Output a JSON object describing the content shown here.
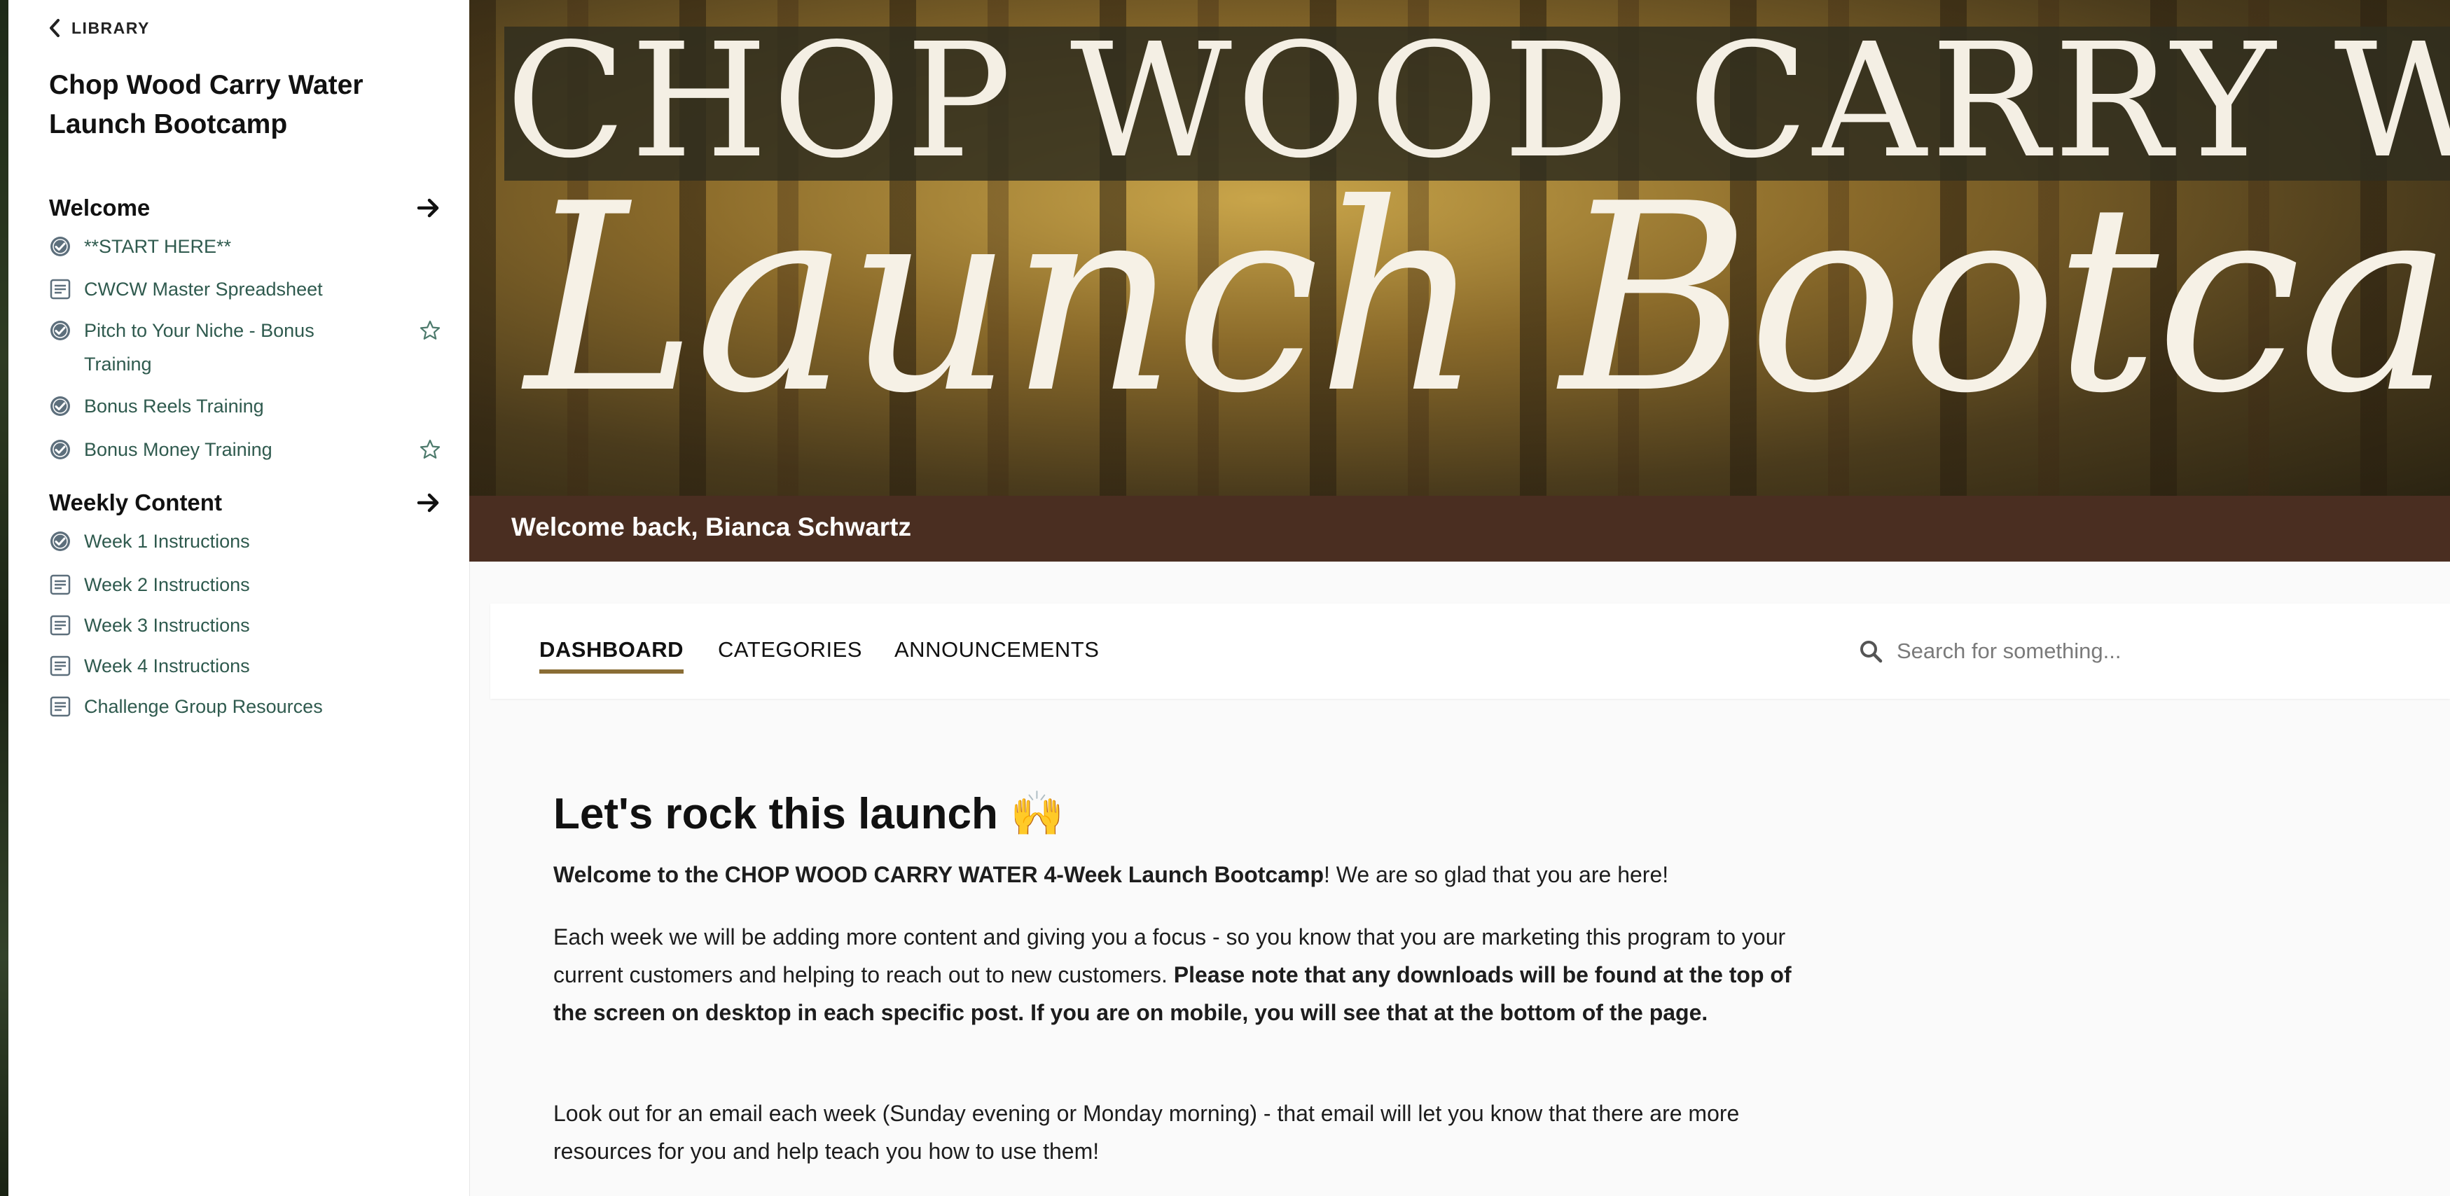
{
  "sidebar": {
    "back_label": "LIBRARY",
    "course_title": "Chop Wood Carry Water Launch Bootcamp",
    "sections": [
      {
        "title": "Welcome",
        "lessons": [
          {
            "label": "**START HERE**",
            "icon": "check-circle-icon",
            "starred": false
          },
          {
            "label": "CWCW Master Spreadsheet",
            "icon": "document-icon",
            "starred": false
          },
          {
            "label": "Pitch to Your Niche - Bonus Training",
            "icon": "check-circle-icon",
            "starred": true
          },
          {
            "label": "Bonus Reels Training",
            "icon": "check-circle-icon",
            "starred": false
          },
          {
            "label": "Bonus Money Training",
            "icon": "check-circle-icon",
            "starred": true
          }
        ]
      },
      {
        "title": "Weekly Content",
        "lessons": [
          {
            "label": "Week 1 Instructions",
            "icon": "check-circle-icon",
            "starred": false
          },
          {
            "label": "Week 2 Instructions",
            "icon": "document-icon",
            "starred": false
          },
          {
            "label": "Week 3 Instructions",
            "icon": "document-icon",
            "starred": false
          },
          {
            "label": "Week 4 Instructions",
            "icon": "document-icon",
            "starred": false
          },
          {
            "label": "Challenge Group Resources",
            "icon": "document-icon",
            "starred": false
          }
        ]
      }
    ]
  },
  "hero": {
    "line1": "CHOP WOOD CARRY WATER",
    "line2": "Launch Bootcamp"
  },
  "welcome_text": "Welcome back, Bianca Schwartz",
  "tabs": [
    {
      "label": "DASHBOARD",
      "active": true
    },
    {
      "label": "CATEGORIES",
      "active": false
    },
    {
      "label": "ANNOUNCEMENTS",
      "active": false
    }
  ],
  "search": {
    "placeholder": "Search for something..."
  },
  "content": {
    "heading": "Let's rock this launch 🙌",
    "p1_bold": "Welcome to the CHOP WOOD CARRY WATER 4-Week Launch Bootcamp",
    "p1_rest": "! We are so glad that you are here!",
    "p2_normal": "Each week we will be adding more content and giving you a focus - so you know that you are marketing this program to your current customers and helping to reach out to new customers. ",
    "p2_bold": "Please note that any downloads will be found at the top of the screen on desktop in each specific post. If you are on mobile, you will see that at the bottom of the page.",
    "p3": "Look out for an email each week (Sunday evening or Monday morning) - that email will let you know that there are more resources for you and help teach you how to use them!"
  },
  "colors": {
    "welcome_bar": "#4a2e21",
    "lesson_link": "#2f5a4e",
    "tab_underline": "#8a6d35"
  }
}
